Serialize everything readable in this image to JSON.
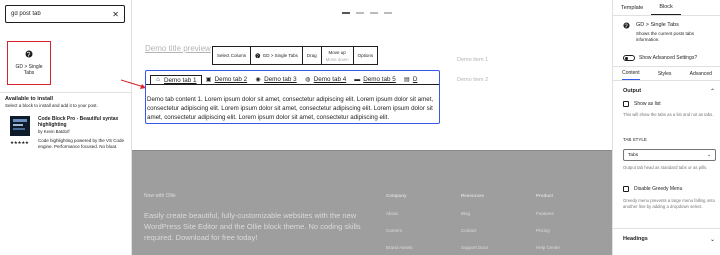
{
  "inserter": {
    "search_value": "gd post tab",
    "clear_icon": "close-icon",
    "result_block_label": "GD > Single Tabs",
    "available_title": "Available to install",
    "available_desc": "Select a block to install and add it to your post.",
    "plugin": {
      "name": "Code Block Pro - Beautiful syntax highlighting",
      "author": "by Kevin Batdorf",
      "stars": "★★★★★",
      "description": "Code highlighting powered by the VS Code engine. Performance focused. No bloat."
    }
  },
  "canvas": {
    "demo_title": "Demo title preview",
    "demo_items": [
      "Demo item 1",
      "Demo item 2"
    ],
    "toolbar": {
      "select_column": "Select Column",
      "type_label": "GD > Single Tabs",
      "drag": "Drag",
      "move_up": "Move up",
      "move_down": "Move down",
      "options": "Options"
    },
    "tabs": [
      {
        "label": "Demo tab 1",
        "icon": "home-icon",
        "glyph": "⌂"
      },
      {
        "label": "Demo tab 2",
        "icon": "image-icon",
        "glyph": "▣"
      },
      {
        "label": "Demo tab 3",
        "icon": "globe-icon",
        "glyph": "◉"
      },
      {
        "label": "Demo tab 4",
        "icon": "comments-icon",
        "glyph": "◍"
      },
      {
        "label": "Demo tab 5",
        "icon": "bed-icon",
        "glyph": "▬"
      },
      {
        "label": "D",
        "icon": "calendar-icon",
        "glyph": "▤"
      }
    ],
    "tab_content": "Demo tab content 1. Lorem ipsum dolor sit amet, consectetur adipiscing elit. Lorem ipsum dolor sit amet, consectetur adipiscing elit. Lorem ipsum dolor sit amet, consectetur adipiscing elit. Lorem ipsum dolor sit amet, consectetur adipiscing elit. Lorem ipsum dolor sit amet, consectetur adipiscing elit.",
    "footer": {
      "brand": "Now with Ollie",
      "tagline": "Easily create beautiful, fully-customizable websites with the new WordPress Site Editor and the Ollie block theme. No coding skills required. Download for free today!",
      "columns": [
        {
          "heading": "Company",
          "items": [
            "About",
            "Careers",
            "Brand Assets"
          ]
        },
        {
          "heading": "Resources",
          "items": [
            "Blog",
            "Contact",
            "Support Docs"
          ]
        },
        {
          "heading": "Product",
          "items": [
            "Features",
            "Pricing",
            "Help Center"
          ]
        }
      ]
    }
  },
  "settings": {
    "tabs": [
      "Template",
      "Block"
    ],
    "block_title": "GD > Single Tabs",
    "block_desc": "Shows the current posts tabs information.",
    "advanced_toggle": "Show Advanced Settings?",
    "sub_tabs": [
      "Content",
      "Styles",
      "Advanced"
    ],
    "output_heading": "Output",
    "show_as_list": "Show as list",
    "show_as_list_help": "This will show the tabs as a list and not as tabs.",
    "tab_style_label": "TAB STYLE",
    "tab_style_value": "Tabs",
    "tab_style_help": "Output tab head as standard tabs or as pills.",
    "greedy_label": "Disable Greedy Menu",
    "greedy_help": "Greedy menu prevents a large menu falling onto another line by adding a dropdown select.",
    "headings": "Headings"
  }
}
